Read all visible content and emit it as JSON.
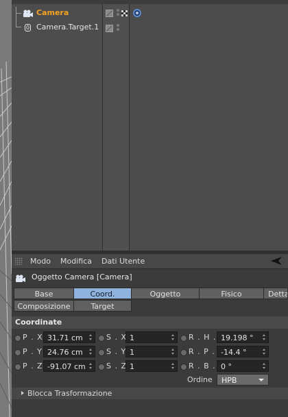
{
  "object_manager": {
    "objects": [
      {
        "name": "Camera",
        "selected": true,
        "icon": "camera-icon"
      },
      {
        "name": "Camera.Target.1",
        "selected": false,
        "icon": "null-object-icon",
        "icon_glyph": "0"
      }
    ],
    "tag_icons": [
      "target-tag-icon"
    ]
  },
  "attribute_manager": {
    "menu": [
      "Modo",
      "Modifica",
      "Dati Utente"
    ],
    "title": "Oggetto Camera [Camera]",
    "tabs_row1": [
      "Base",
      "Coord.",
      "Oggetto",
      "Fisico",
      "Dettagli"
    ],
    "tabs_row2": [
      "Composizione",
      "Target"
    ],
    "active_tab": "Coord.",
    "section": "Coordinate",
    "coords": [
      {
        "label": "P . X",
        "value": "31.71 cm",
        "s_label": "S . X",
        "s_value": "1",
        "r_label": "R . H . .",
        "r_value": "19.198 °"
      },
      {
        "label": "P . Y",
        "value": "24.76 cm",
        "s_label": "S . Y",
        "s_value": "1",
        "r_label": "R . P . .",
        "r_value": "-14.4 °"
      },
      {
        "label": "P . Z",
        "value": "-91.07 cm",
        "s_label": "S . Z",
        "s_value": "1",
        "r_label": "R . B . .",
        "r_value": "0 °"
      }
    ],
    "order_label": "Ordine",
    "order_value": "HPB",
    "fold_label": "Blocca Trasformazione",
    "colors": {
      "accent_selected": "#f4a21f",
      "tab_active": "#8fb3dc"
    }
  }
}
